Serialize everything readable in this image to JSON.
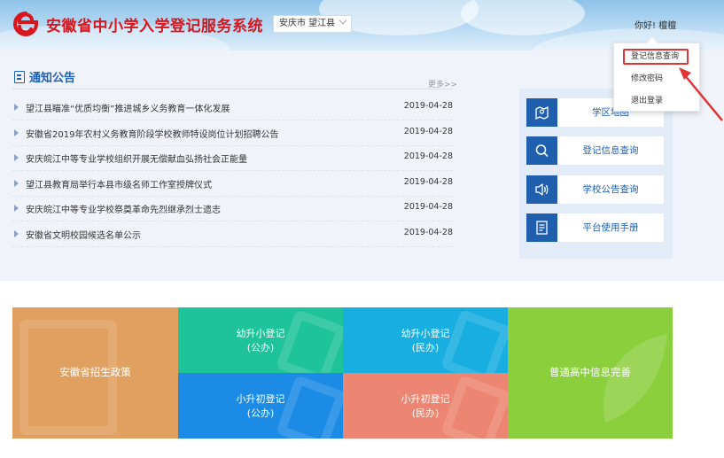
{
  "header": {
    "title": "安徽省中小学入学登记服务系统",
    "region": "安庆市 望江县",
    "greeting": "你好!",
    "username": "檀檀"
  },
  "user_menu": {
    "items": [
      {
        "label": "登记信息查询"
      },
      {
        "label": "修改密码"
      },
      {
        "label": "退出登录"
      }
    ]
  },
  "notice": {
    "title": "通知公告",
    "more": "更多>>",
    "items": [
      {
        "title": "望江县瞄准“优质均衡”推进城乡义务教育一体化发展",
        "date": "2019-04-28"
      },
      {
        "title": "安徽省2019年农村义务教育阶段学校教师特设岗位计划招聘公告",
        "date": "2019-04-28"
      },
      {
        "title": "安庆皖江中等专业学校组织开展无偿献血弘扬社会正能量",
        "date": "2019-04-28"
      },
      {
        "title": "望江县教育局举行本县市级名师工作室授牌仪式",
        "date": "2019-04-28"
      },
      {
        "title": "安庆皖江中等专业学校祭奠革命先烈继承烈士遗志",
        "date": "2019-04-28"
      },
      {
        "title": "安徽省文明校园候选名单公示",
        "date": "2019-04-28"
      }
    ]
  },
  "quick_links": [
    {
      "label": "学区地图",
      "icon": "map-icon"
    },
    {
      "label": "登记信息查询",
      "icon": "search-icon"
    },
    {
      "label": "学校公告查询",
      "icon": "speaker-icon"
    },
    {
      "label": "平台使用手册",
      "icon": "manual-icon"
    }
  ],
  "tiles": {
    "policy": "安徽省招生政策",
    "kindergarten_public": [
      "幼升小登记",
      "(公办)"
    ],
    "kindergarten_private": [
      "幼升小登记",
      "(民办)"
    ],
    "primary_public": [
      "小升初登记",
      "(公办)"
    ],
    "primary_private": [
      "小升初登记",
      "(民办)"
    ],
    "high_school": "普通高中信息完善"
  },
  "colors": {
    "title_red": "#d7161d",
    "primary_blue": "#1f5fae",
    "tile_orange": "#e0a060",
    "tile_teal": "#1fc39a",
    "tile_cyan": "#18aee0",
    "tile_blue": "#1c8be6",
    "tile_salmon": "#ec8672",
    "tile_green": "#8ccf3c",
    "highlight_red": "#e03535"
  }
}
